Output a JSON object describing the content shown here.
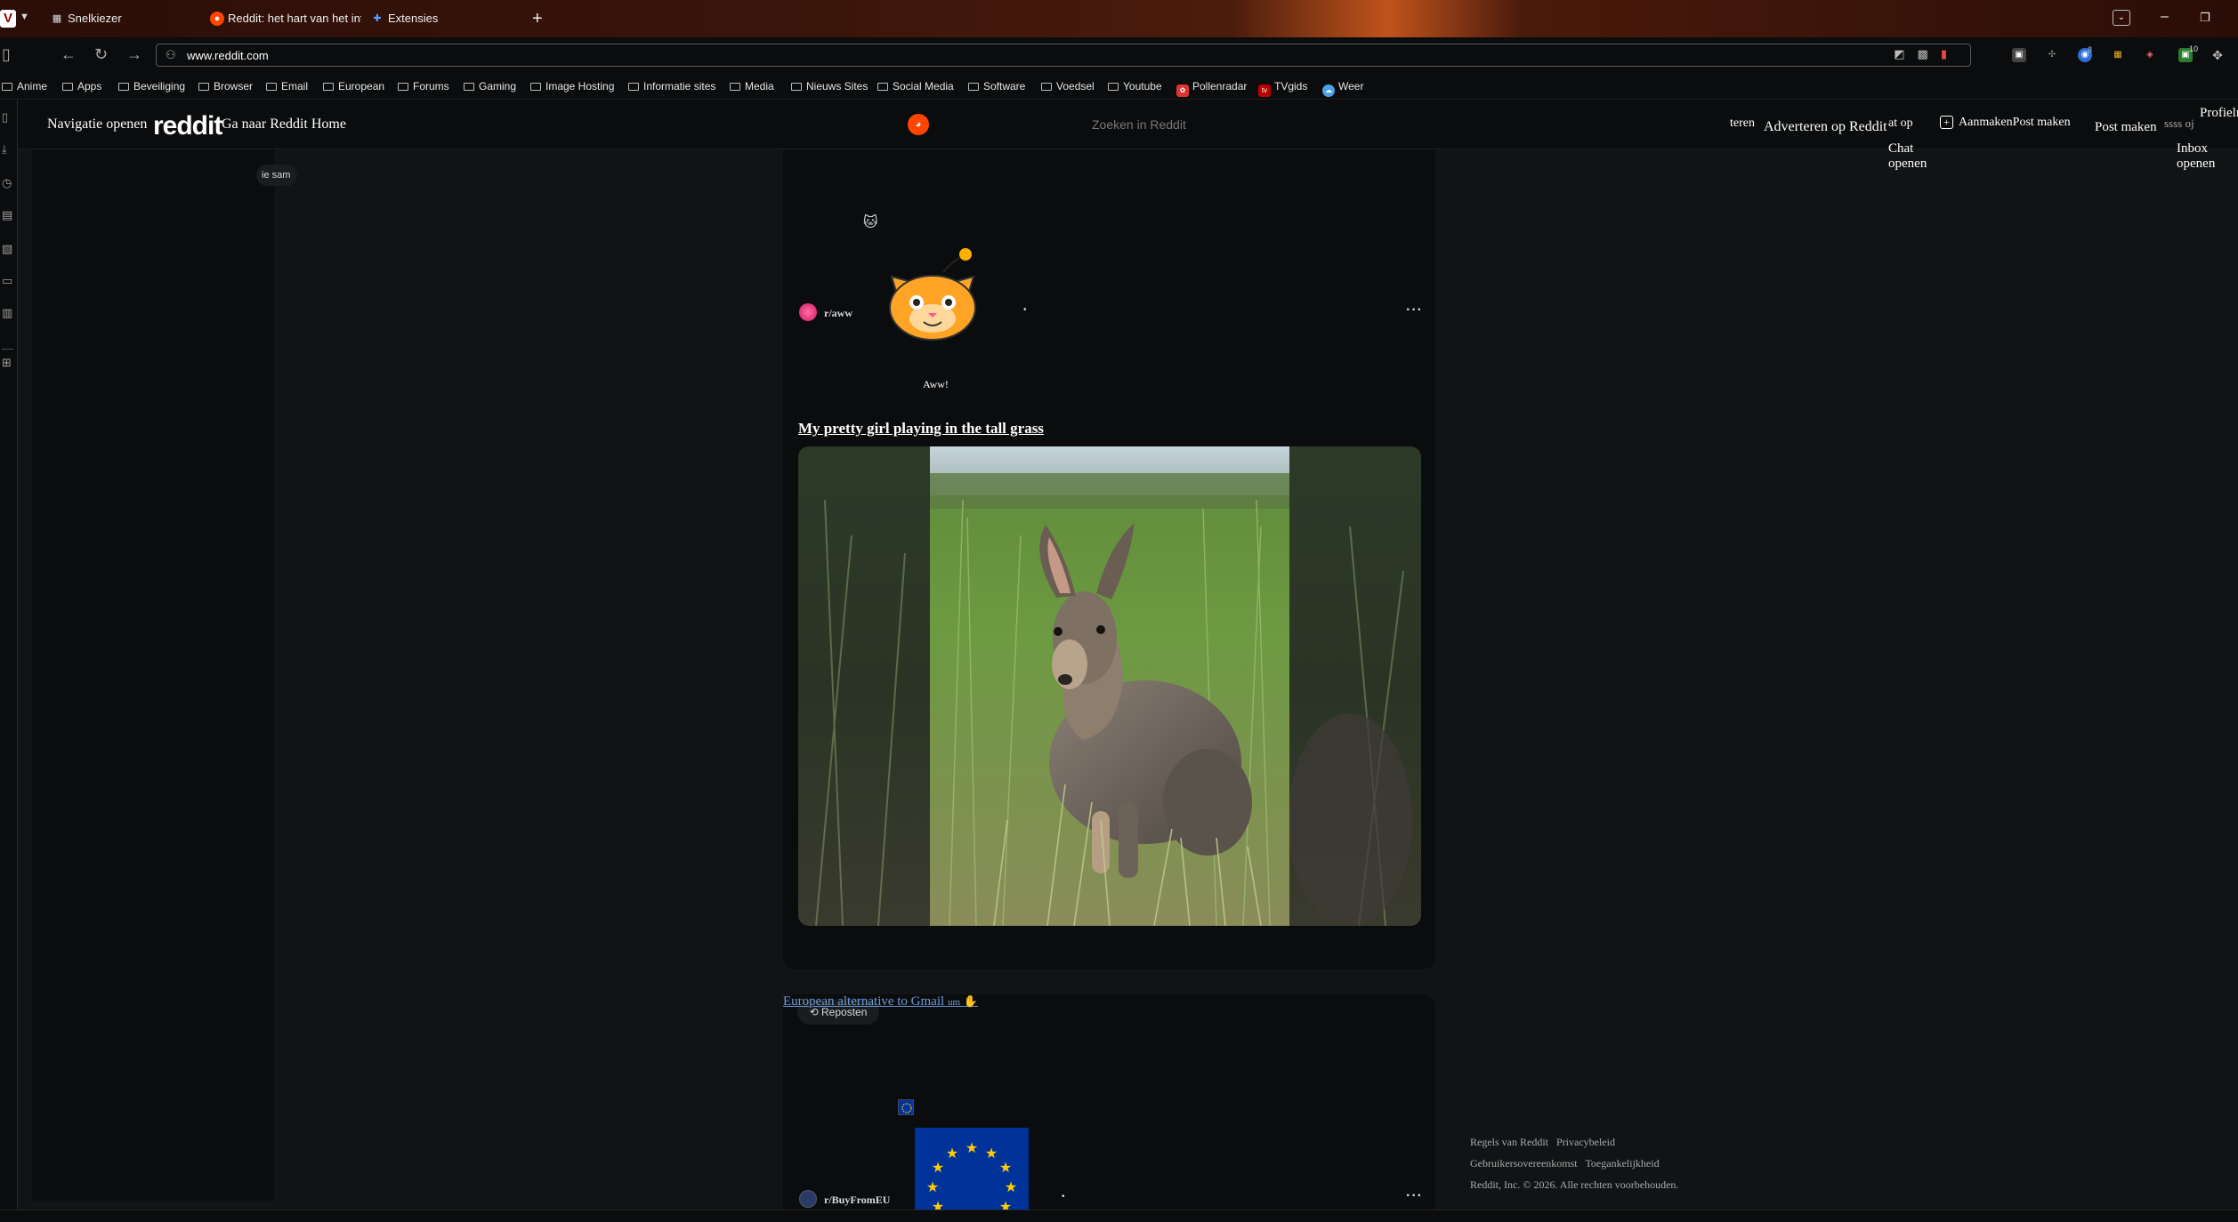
{
  "browser": {
    "tabs": [
      {
        "label": "Snelkiezer"
      },
      {
        "label": "Reddit: het hart van het internet"
      },
      {
        "label": "Extensies"
      }
    ],
    "new_tab": "+",
    "url": "www.reddit.com",
    "extension_badges": {
      "ext_a": "8",
      "ext_b": "10"
    }
  },
  "bookmarks": [
    "Anime",
    "Apps",
    "Beveiliging",
    "Browser",
    "Email",
    "European",
    "Forums",
    "Gaming",
    "Image Hosting",
    "Informatie sites",
    "Media",
    "Nieuws Sites",
    "Social Media",
    "Software",
    "Voedsel",
    "Youtube",
    "Pollenradar",
    "TVgids",
    "Weer"
  ],
  "reddit_header": {
    "open_nav": "Navigatie openen",
    "logo": "reddit",
    "home_link": "Ga naar Reddit Home",
    "search_placeholder": "Zoeken in Reddit",
    "partial_teren": "teren ",
    "advertise": "Adverteren op Reddit",
    "partial_chat": "at op",
    "chat_open": "Chat openen",
    "create": "Aanmaken",
    "create_post": "Post maken",
    "post_make": "Post maken",
    "partial_overlap": "ssss oj",
    "inbox_open": "Inbox openen",
    "profile": "Profielme"
  },
  "left_nav": {
    "pill_text": "ie sam"
  },
  "posts": [
    {
      "subreddit": "r/aww",
      "dot": "•",
      "more": "···",
      "avatar_label": "Aww!",
      "title": "My pretty girl playing in the tall grass"
    },
    {
      "link_title": "European alternative to Gmail",
      "link_suffix": "um",
      "repost": "Reposten",
      "subreddit": "r/BuyFromEU",
      "dot": "•",
      "more": "···"
    }
  ],
  "footer": {
    "rules": "Regels van Reddit",
    "privacy": "Privacybeleid",
    "user_agreement": "Gebruikersovereenkomst",
    "accessibility": "Toegankelijkheid",
    "copyright": "Reddit, Inc. © 2026. Alle rechten voorbehouden."
  },
  "colors": {
    "background": "#111314",
    "card": "#0b0c0d",
    "reddit_orange": "#ff4500",
    "link_blue": "#6e9bd8",
    "eu_blue": "#003399",
    "eu_gold": "#ffcc00"
  }
}
